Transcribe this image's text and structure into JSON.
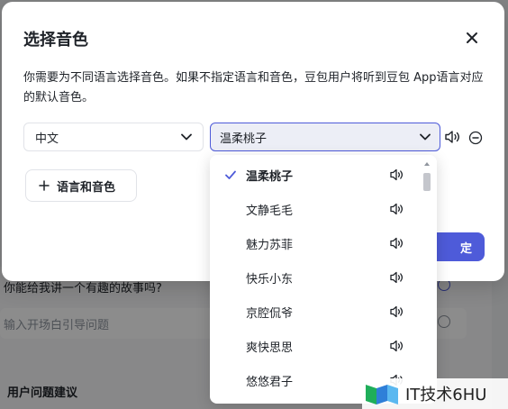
{
  "background": {
    "question_text": "你能给我讲一个有趣的故事吗?",
    "input_placeholder": "输入开场白引导问题",
    "section_title": "用户问题建议"
  },
  "modal": {
    "title": "选择音色",
    "description": "你需要为不同语言选择音色。如果不指定语言和音色，豆包用户将听到豆包 App语言对应的默认音色。",
    "language_value": "中文",
    "voice_value": "温柔桃子",
    "add_button_label": "语言和音色",
    "confirm_label": "定"
  },
  "dropdown": {
    "options": [
      {
        "label": "温柔桃子",
        "selected": true
      },
      {
        "label": "文静毛毛",
        "selected": false
      },
      {
        "label": "魅力苏菲",
        "selected": false
      },
      {
        "label": "快乐小东",
        "selected": false
      },
      {
        "label": "京腔侃爷",
        "selected": false
      },
      {
        "label": "爽快思思",
        "selected": false
      },
      {
        "label": "悠悠君子",
        "selected": false
      }
    ]
  },
  "watermark": {
    "text": "IT技术6HU"
  },
  "colors": {
    "accent": "#4e5bd9",
    "text": "#1f2329",
    "muted": "#8f959e",
    "border": "#e1e3e8"
  },
  "icons": {
    "close": "close-icon",
    "chevron": "chevron-down-icon",
    "speaker": "speaker-icon",
    "remove": "minus-circle-icon",
    "add": "plus-icon",
    "check": "check-icon"
  }
}
